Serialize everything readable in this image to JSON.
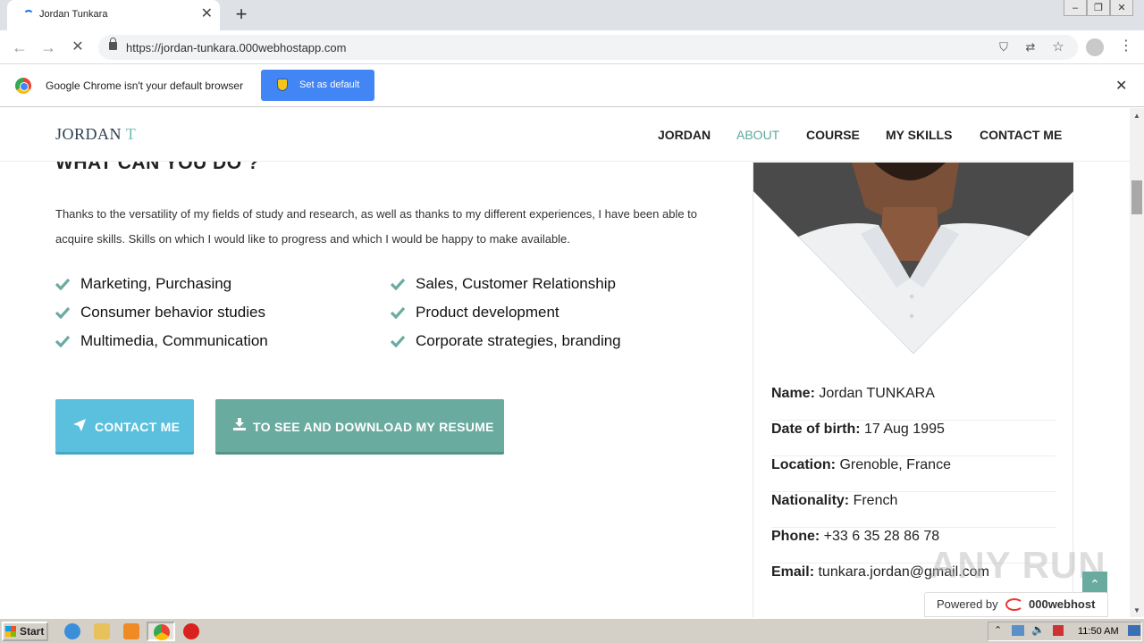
{
  "browser": {
    "tab_title": "Jordan Tunkara",
    "url": "https://jordan-tunkara.000webhostapp.com",
    "infobar_text": "Google Chrome isn't your default browser",
    "set_default_label": "Set as default"
  },
  "site": {
    "logo_main": "JORDAN",
    "logo_accent": "T",
    "nav": [
      {
        "label": "JORDAN",
        "active": false
      },
      {
        "label": "ABOUT",
        "active": true
      },
      {
        "label": "COURSE",
        "active": false
      },
      {
        "label": "MY SKILLS",
        "active": false
      },
      {
        "label": "CONTACT ME",
        "active": false
      }
    ],
    "section_title": "WHAT CAN YOU DO ?",
    "intro": "Thanks to the versatility of my fields of study and research, as well as thanks to my different experiences, I have been able to acquire skills. Skills on which I would like to progress and which I would be happy to make available.",
    "skills": [
      "Marketing, Purchasing",
      "Sales, Customer Relationship",
      "Consumer behavior studies",
      "Product development",
      "Multimedia, Communication",
      "Corporate strategies, branding"
    ],
    "buttons": {
      "contact": "CONTACT ME",
      "resume": "TO SEE AND DOWNLOAD MY RESUME"
    },
    "profile": [
      {
        "label": "Name:",
        "value": "Jordan TUNKARA"
      },
      {
        "label": "Date of birth:",
        "value": "17 Aug 1995"
      },
      {
        "label": "Location:",
        "value": "Grenoble, France"
      },
      {
        "label": "Nationality:",
        "value": "French"
      },
      {
        "label": "Phone:",
        "value": "+33 6 35 28 86 78"
      },
      {
        "label": "Email:",
        "value": "tunkara.jordan@gmail.com"
      }
    ],
    "powered_by": "Powered by",
    "host_brand": "000webhost",
    "watermark": "ANY RUN"
  },
  "taskbar": {
    "start_label": "Start",
    "clock": "11:50 AM"
  },
  "colors": {
    "accent": "#6aaba0",
    "contact_button": "#5bc0de",
    "chrome_blue": "#4285f4"
  }
}
